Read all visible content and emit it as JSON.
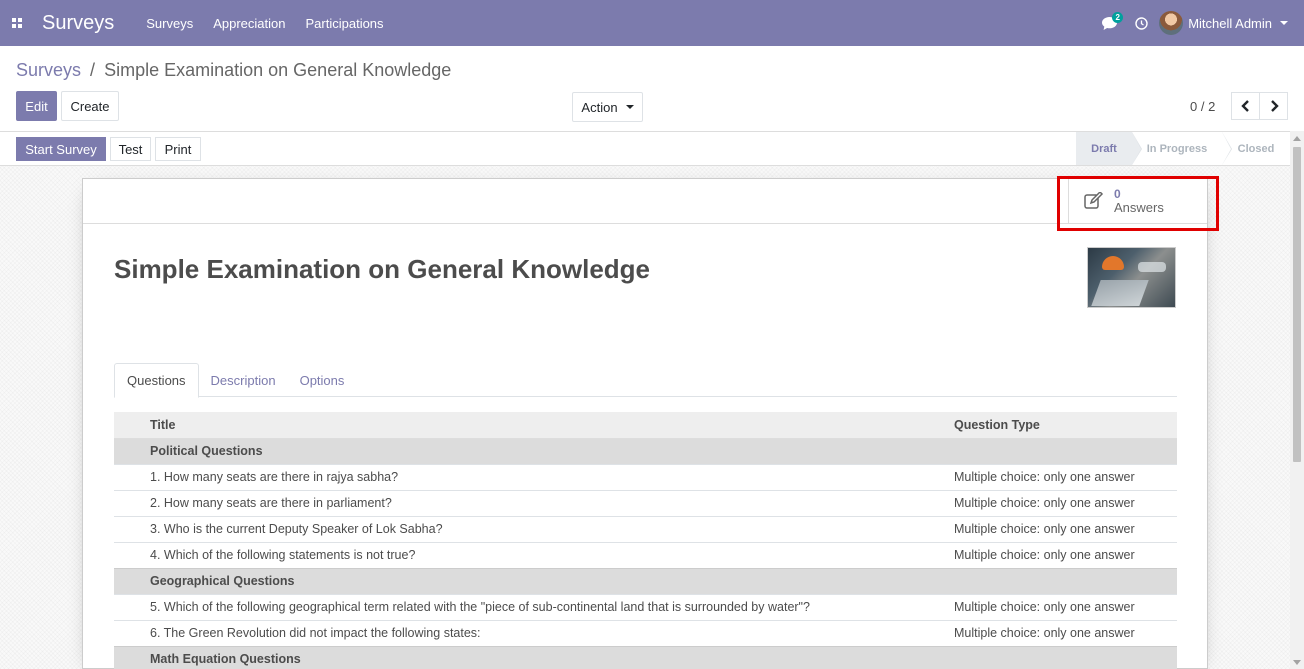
{
  "navbar": {
    "brand": "Surveys",
    "menu": [
      "Surveys",
      "Appreciation",
      "Participations"
    ],
    "chat_badge": "2",
    "user_name": "Mitchell Admin",
    "color": "#7c7bad"
  },
  "breadcrumb": {
    "parent": "Surveys",
    "separator": "/",
    "current": "Simple Examination on General Knowledge"
  },
  "buttons": {
    "edit": "Edit",
    "create": "Create",
    "action": "Action"
  },
  "pager": {
    "value": "0 / 2"
  },
  "statusbar": {
    "start_survey": "Start Survey",
    "test": "Test",
    "print": "Print",
    "stages": [
      "Draft",
      "In Progress",
      "Closed"
    ],
    "current_stage": "Draft"
  },
  "stat_button": {
    "value": "0",
    "label": "Answers",
    "icon": "edit-icon"
  },
  "form": {
    "title": "Simple Examination on General Knowledge"
  },
  "tabs": [
    "Questions",
    "Description",
    "Options"
  ],
  "active_tab": "Questions",
  "table": {
    "headers": [
      "Title",
      "Question Type"
    ],
    "rows": [
      {
        "type": "section",
        "title": "Political Questions",
        "qtype": ""
      },
      {
        "type": "row",
        "title": "1. How many seats are there in rajya sabha?",
        "qtype": "Multiple choice: only one answer"
      },
      {
        "type": "row",
        "title": "2. How many seats are there in parliament?",
        "qtype": "Multiple choice: only one answer"
      },
      {
        "type": "row",
        "title": "3. Who is the current Deputy Speaker of Lok Sabha?",
        "qtype": "Multiple choice: only one answer"
      },
      {
        "type": "row",
        "title": "4. Which of the following statements is not true?",
        "qtype": "Multiple choice: only one answer"
      },
      {
        "type": "section",
        "title": "Geographical Questions",
        "qtype": ""
      },
      {
        "type": "row",
        "title": "5. Which of the following geographical term related with the \"piece of sub-continental land that is surrounded by water\"?",
        "qtype": "Multiple choice: only one answer"
      },
      {
        "type": "row",
        "title": "6. The Green Revolution did not impact the following states:",
        "qtype": "Multiple choice: only one answer"
      },
      {
        "type": "section",
        "title": "Math Equation Questions",
        "qtype": ""
      }
    ]
  }
}
